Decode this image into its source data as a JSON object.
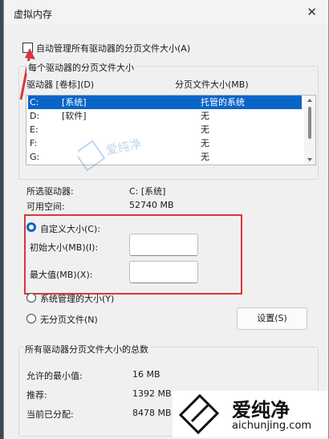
{
  "window": {
    "title": "虚拟内存"
  },
  "auto_manage": {
    "label": "自动管理所有驱动器的分页文件大小(A)",
    "checked": false
  },
  "drives_group": {
    "title": "每个驱动器的分页文件大小"
  },
  "columns": {
    "drive": "驱动器 [卷标](D)",
    "paging": "分页文件大小(MB)"
  },
  "drives": [
    {
      "letter": "C:",
      "label": "[系统]",
      "size": "托管的系统",
      "selected": true
    },
    {
      "letter": "D:",
      "label": "[软件]",
      "size": "无",
      "selected": false
    },
    {
      "letter": "E:",
      "label": "",
      "size": "无",
      "selected": false
    },
    {
      "letter": "F:",
      "label": "",
      "size": "无",
      "selected": false
    },
    {
      "letter": "G:",
      "label": "",
      "size": "无",
      "selected": false
    }
  ],
  "selected_drive": {
    "label": "所选驱动器:",
    "value": "C:  [系统]"
  },
  "free_space": {
    "label": "可用空间:",
    "value": "52740 MB"
  },
  "options": {
    "custom": "自定义大小(C):",
    "initial": "初始大小(MB)(I):",
    "max": "最大值(MB)(X):",
    "system": "系统管理的大小(Y)",
    "none": "无分页文件(N)",
    "set_button": "设置(S)",
    "initial_value": "",
    "max_value": ""
  },
  "totals": {
    "title": "所有驱动器分页文件大小的总数",
    "min_label": "允许的最小值:",
    "min_value": "16 MB",
    "rec_label": "推荐:",
    "rec_value": "1392 MB",
    "cur_label": "当前已分配:",
    "cur_value": "8478 MB"
  },
  "watermark": {
    "brand": "爱纯净",
    "url": "aichunjing.com"
  },
  "colors": {
    "accent": "#0a64c8",
    "annotation": "#d9363e"
  }
}
